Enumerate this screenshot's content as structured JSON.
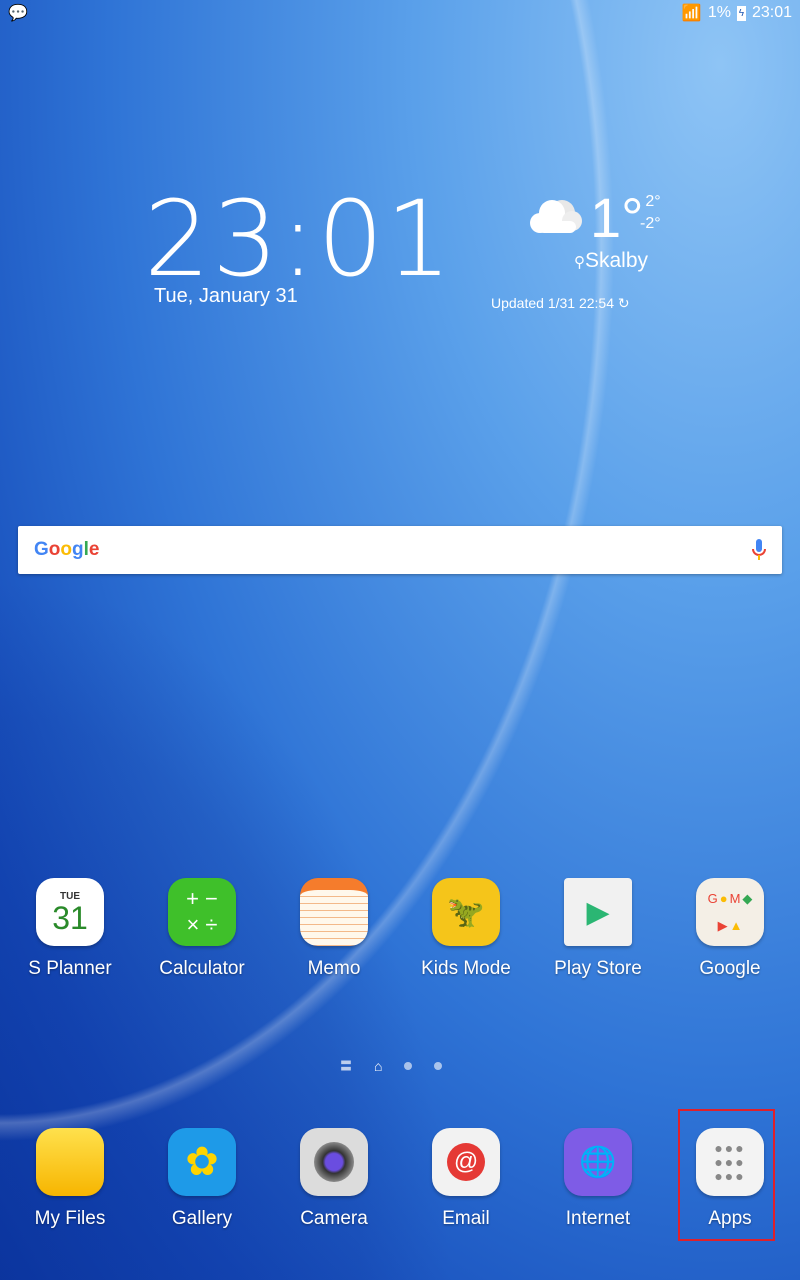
{
  "status": {
    "notification_icon": "hangouts-icon",
    "battery": "1%",
    "time": "23:01",
    "wifi_icon": "wifi-icon",
    "battery_icon": "battery-charging-icon"
  },
  "clock": {
    "time": "23:01",
    "date": "Tue, January 31"
  },
  "weather": {
    "temp": "1°",
    "high": "2°",
    "low": "-2°",
    "location": "Skalby",
    "updated": "Updated 1/31 22:54",
    "icon": "cloud-icon"
  },
  "search": {
    "logo": "Google",
    "mic_icon": "mic-icon"
  },
  "apps": [
    {
      "label": "S Planner",
      "badge": "TUE",
      "day": "31"
    },
    {
      "label": "Calculator"
    },
    {
      "label": "Memo"
    },
    {
      "label": "Kids Mode"
    },
    {
      "label": "Play Store"
    },
    {
      "label": "Google"
    }
  ],
  "dock": [
    {
      "label": "My Files"
    },
    {
      "label": "Gallery"
    },
    {
      "label": "Camera"
    },
    {
      "label": "Email"
    },
    {
      "label": "Internet"
    },
    {
      "label": "Apps"
    }
  ],
  "pager": {
    "current": "home",
    "pages": 3
  },
  "highlight_color": "#e0202a"
}
